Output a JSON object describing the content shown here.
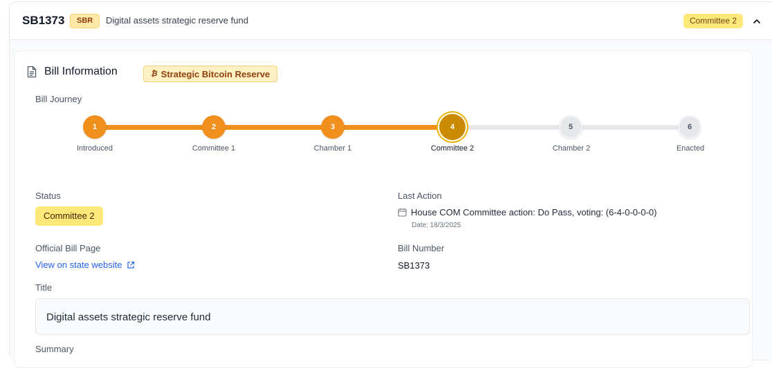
{
  "bill": {
    "id": "SB1373",
    "tag": "SBR",
    "description": "Digital assets strategic reserve fund",
    "status_pill": "Committee 2"
  },
  "info": {
    "section_title": "Bill Information",
    "topic_badge": "Strategic Bitcoin Reserve",
    "journey_label": "Bill Journey",
    "steps": [
      {
        "num": "1",
        "label": "Introduced",
        "state": "done"
      },
      {
        "num": "2",
        "label": "Committee 1",
        "state": "done"
      },
      {
        "num": "3",
        "label": "Chamber 1",
        "state": "done"
      },
      {
        "num": "4",
        "label": "Committee 2",
        "state": "current"
      },
      {
        "num": "5",
        "label": "Chamber 2",
        "state": "todo"
      },
      {
        "num": "6",
        "label": "Enacted",
        "state": "todo"
      }
    ],
    "status_label": "Status",
    "status_value": "Committee 2",
    "last_action_label": "Last Action",
    "last_action_text": "House COM Committee action: Do Pass, voting: (6-4-0-0-0-0)",
    "last_action_date": "Date: 18/3/2025",
    "official_page_label": "Official Bill Page",
    "official_page_link": "View on state website",
    "bill_number_label": "Bill Number",
    "bill_number_value": "SB1373",
    "title_label": "Title",
    "title_value": "Digital assets strategic reserve fund",
    "summary_label": "Summary"
  },
  "colors": {
    "accent_orange": "#f18f1c",
    "current_step": "#ca8a04",
    "status_yellow": "#fde979",
    "link_blue": "#2563eb"
  },
  "icons": {
    "section": "document-icon",
    "collapse": "chevron-up-icon",
    "calendar": "calendar-icon",
    "external": "external-link-icon",
    "bitcoin": "bitcoin-icon"
  }
}
